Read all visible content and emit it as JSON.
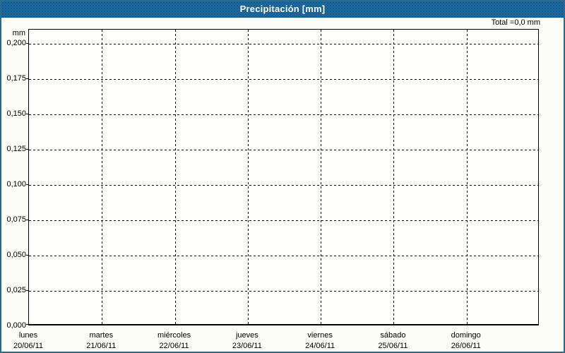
{
  "window": {
    "title": "Precipitación [mm]"
  },
  "chart_data": {
    "type": "bar",
    "title": "Precipitación [mm]",
    "total_label": "Total =0,0 mm",
    "grid": "dashed-black",
    "legend": "none",
    "y_axis": {
      "unit": "mm",
      "min": 0.0,
      "max": 0.2,
      "tick_step": 0.025,
      "tick_labels": [
        "0,200",
        "0,175",
        "0,150",
        "0,125",
        "0,100",
        "0,075",
        "0,050",
        "0,025",
        "0,000"
      ],
      "tick_values": [
        0.2,
        0.175,
        0.15,
        0.125,
        0.1,
        0.075,
        0.05,
        0.025,
        0.0
      ]
    },
    "x_axis": {
      "days": [
        {
          "label": "lunes",
          "date": "20/06/11"
        },
        {
          "label": "martes",
          "date": "21/06/11"
        },
        {
          "label": "miércoles",
          "date": "22/06/11"
        },
        {
          "label": "jueves",
          "date": "23/06/11"
        },
        {
          "label": "viernes",
          "date": "24/06/11"
        },
        {
          "label": "sábado",
          "date": "25/06/11"
        },
        {
          "label": "domingo",
          "date": "26/06/11"
        }
      ]
    },
    "series": [
      {
        "name": "Precipitación",
        "values": [
          0,
          0,
          0,
          0,
          0,
          0,
          0
        ]
      }
    ],
    "total_mm": 0.0
  },
  "colors": {
    "title_bar_bg": "#1d6ca3",
    "title_text": "#ffffff",
    "frame_border": "#2b6b90",
    "background": "#fdfdf7",
    "plot_background": "#fffffe",
    "grid_line": "#000000",
    "text": "#000000"
  }
}
